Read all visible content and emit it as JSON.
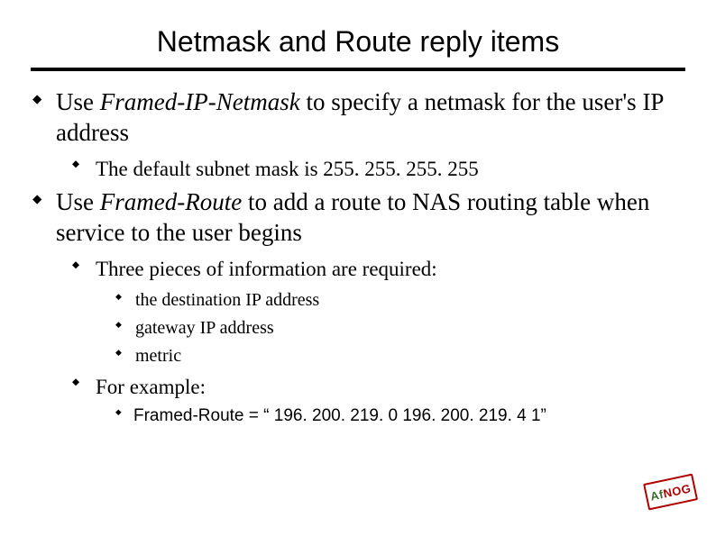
{
  "title": "Netmask and Route reply items",
  "points": {
    "p1a": "Use ",
    "p1b": "Framed-IP-Netmask",
    "p1c": " to specify a netmask for the user's IP address",
    "p1_1": "The default subnet mask is 255. 255. 255. 255",
    "p2a": "Use ",
    "p2b": "Framed-Route",
    "p2c": " to add a route to NAS routing table when service to the user begins",
    "p2_1": "Three pieces of information are required:",
    "p2_1_1": "the destination IP address",
    "p2_1_2": "gateway IP address",
    "p2_1_3": "metric",
    "p2_2": "For example:",
    "p2_2_1": "Framed-Route = “ 196. 200. 219. 0 196. 200. 219. 4 1”"
  },
  "logo": {
    "af": "Af",
    "nog": "NOG"
  }
}
